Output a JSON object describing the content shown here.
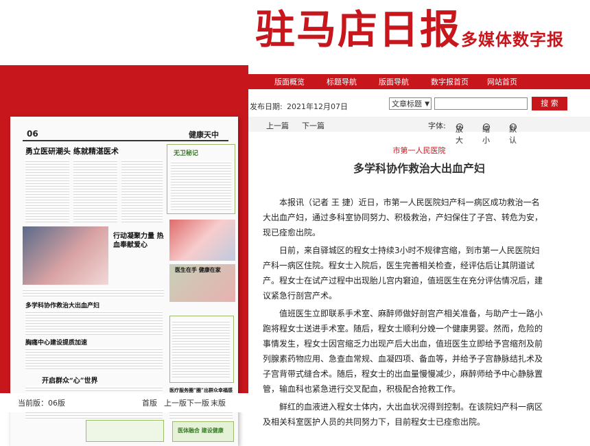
{
  "header": {
    "masthead": "驻马店日报",
    "tagline": "多媒体数字报"
  },
  "nav": {
    "items": [
      "版面概览",
      "标题导航",
      "版面导航",
      "数字报首页",
      "网站首页"
    ]
  },
  "colors": {
    "brand": "#c8161d"
  },
  "left_panel": {
    "page_number": "06",
    "section": "健康天中",
    "headlines": {
      "main": "勇立医研潮头  练就精湛医术",
      "box1": "无卫秘记",
      "photo_caption": "行动凝聚力量 热血奉献爱心",
      "h2": "多学科协作救治大出血产妇",
      "h3": "胸痛中心建设提质加速",
      "h4": "开启群众“心”世界",
      "h5": "医疗服务圈“圈”出群众幸福感",
      "h6": "医体融合  建设健康",
      "right_small": "医生在手  健康在家"
    },
    "status": {
      "current_label": "当前版：06版",
      "first": "首版",
      "prev": "上一版",
      "next": "下一版",
      "last": "末版"
    }
  },
  "datebar": {
    "date_label": "发布日期:",
    "date_value": "2021年12月07日",
    "select_value": "文章标题",
    "search_value": "",
    "search_button": "搜  索"
  },
  "toolbar": {
    "prev": "上一篇",
    "next": "下一篇",
    "font_label": "字体:",
    "zoom_in": "放大",
    "zoom_out": "缩小",
    "default": "默认"
  },
  "article": {
    "subtitle": "市第一人民医院",
    "title": "多学科协作救治大出血产妇",
    "paragraphs": [
      "本报讯（记者 王 捷）近日，市第一人民医院妇产科一病区成功救治一名大出血产妇，通过多科室协同努力、积极救治，产妇保住了子宫、转危为安，现已痊愈出院。",
      "日前，来自驿城区的程女士持续3小时不规律宫缩，到市第一人民医院妇产科一病区住院。程女士入院后，医生完善相关检查，经评估后让其阴道试产。程女士在试产过程中出现胎儿宫内窘迫，值班医生在充分评估情况后，建议紧急行剖宫产术。",
      "值班医生立即联系手术室、麻醉师做好剖宫产相关准备，与助产士一路小跑将程女士送进手术室。随后，程女士顺利分娩一个健康男婴。然而，危险的事情发生，程女士因宫缩乏力出现产后大出血，值班医生立即给予宫缩剂及前列腺素药物应用、急查血常规、血凝四项、备血等，并给予子宫静脉结扎术及子宫背带式缝合术。随后，程女士的出血量慢慢减少，麻醉师给予中心静脉置管，输血科也紧急进行交叉配血，积极配合抢救工作。",
      "鲜红的血液进入程女士体内，大出血状况得到控制。在该院妇产科一病区及相关科室医护人员的共同努力下，目前程女士已痊愈出院。"
    ]
  }
}
